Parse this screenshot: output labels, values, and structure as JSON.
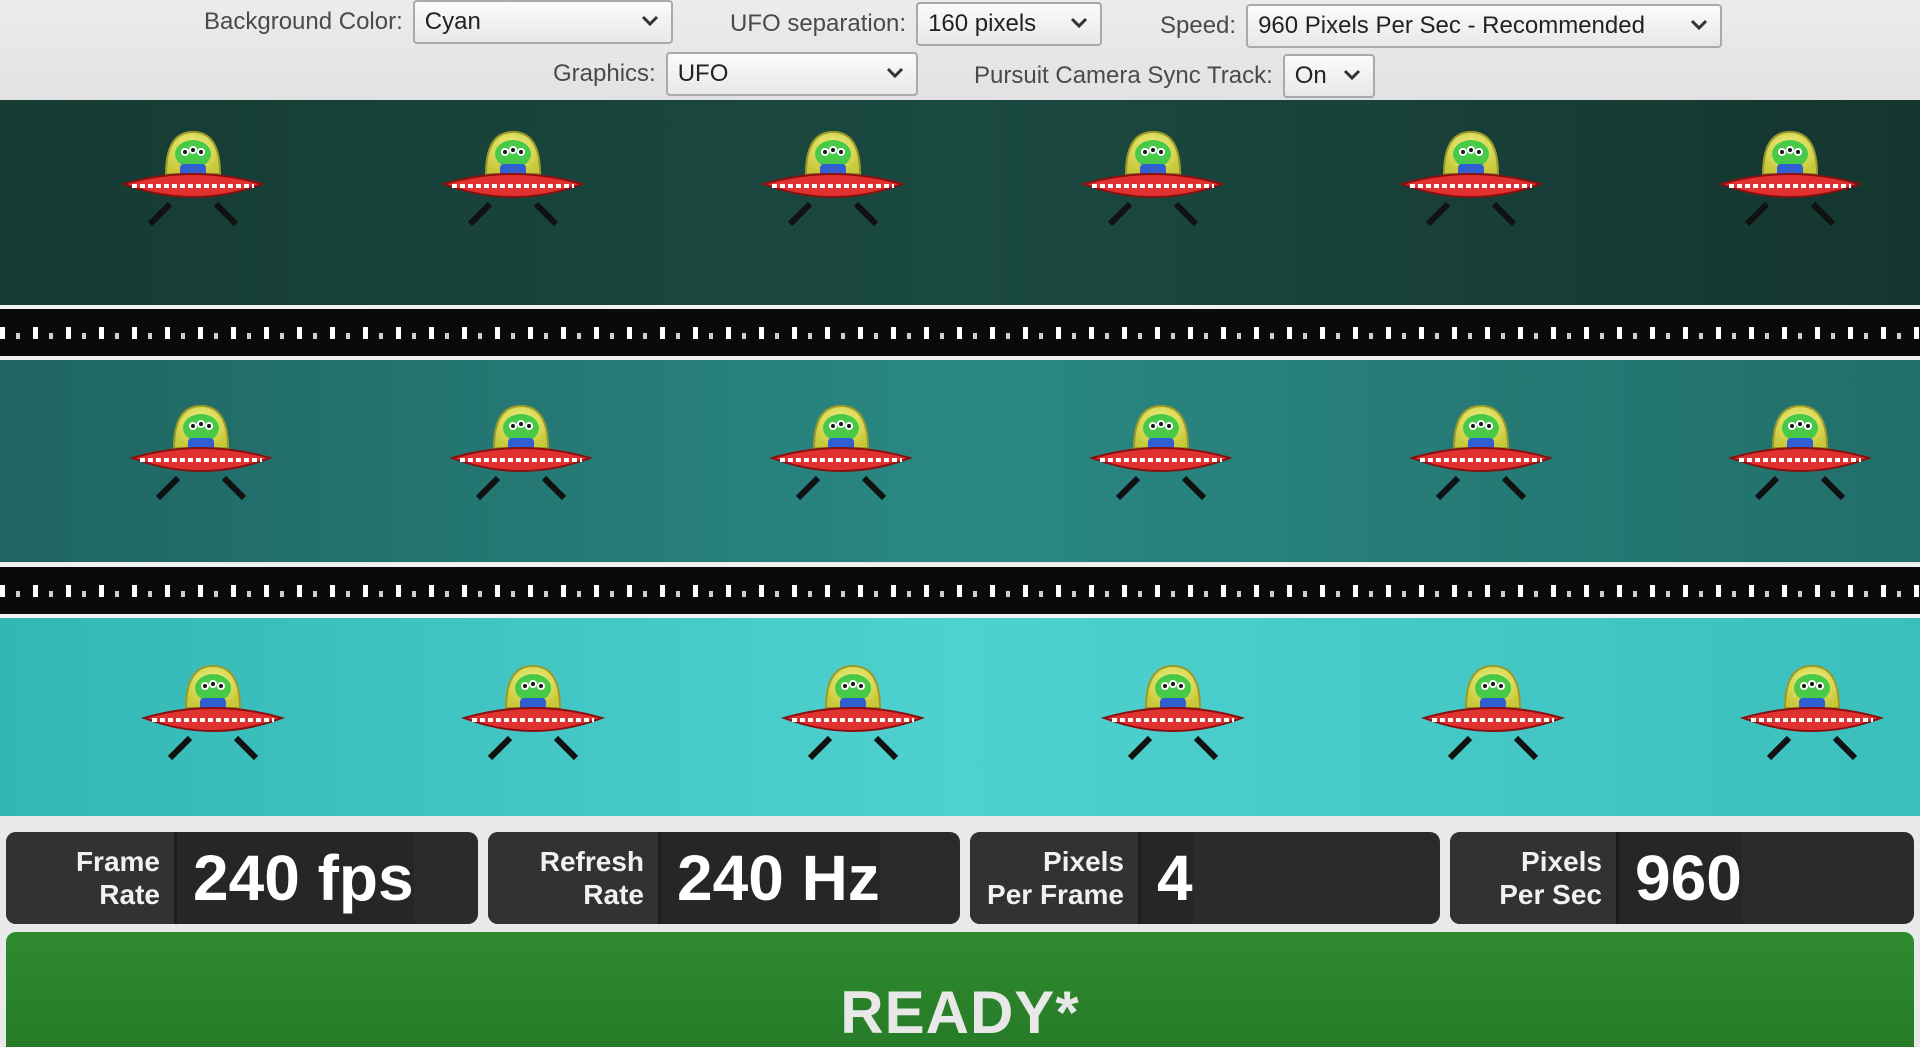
{
  "controls": {
    "background_color": {
      "label": "Background Color:",
      "value": "Cyan"
    },
    "ufo_separation": {
      "label": "UFO separation:",
      "value": "160 pixels"
    },
    "speed": {
      "label": "Speed:",
      "value": "960 Pixels Per Sec - Recommended"
    },
    "graphics": {
      "label": "Graphics:",
      "value": "UFO"
    },
    "pursuit_sync": {
      "label": "Pursuit Camera Sync Track:",
      "value": "On"
    }
  },
  "lanes": [
    {
      "name": "dark",
      "color": "#1b4a41",
      "ufo_count": 6
    },
    {
      "name": "medium",
      "color": "#2a8883",
      "ufo_count": 6
    },
    {
      "name": "light",
      "color": "#4fd1cf",
      "ufo_count": 6
    }
  ],
  "stats": {
    "frame_rate": {
      "label_line1": "Frame",
      "label_line2": "Rate",
      "value": "240 fps"
    },
    "refresh_rate": {
      "label_line1": "Refresh",
      "label_line2": "Rate",
      "value": "240 Hz"
    },
    "pixels_per_frame": {
      "label_line1": "Pixels",
      "label_line2": "Per Frame",
      "value": "4"
    },
    "pixels_per_sec": {
      "label_line1": "Pixels",
      "label_line2": "Per Sec",
      "value": "960"
    }
  },
  "status": {
    "text": "READY*",
    "color": "#2f8a2f"
  },
  "icons": [
    "chevron-down-icon",
    "ufo-alien-icon"
  ]
}
